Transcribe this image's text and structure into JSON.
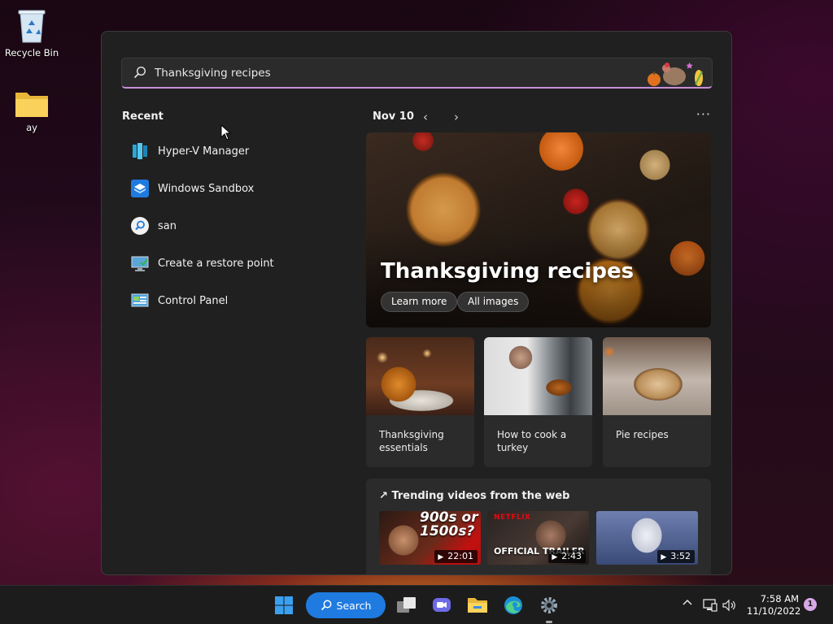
{
  "desktop": {
    "recycle_bin_label": "Recycle Bin",
    "folder_label": "ay"
  },
  "search": {
    "value": "Thanksgiving recipes"
  },
  "recent": {
    "title": "Recent",
    "items": [
      {
        "label": "Hyper-V Manager",
        "icon": "hyper-v-icon"
      },
      {
        "label": "Windows Sandbox",
        "icon": "sandbox-icon"
      },
      {
        "label": "san",
        "icon": "search-icon"
      },
      {
        "label": "Create a restore point",
        "icon": "system-properties-icon"
      },
      {
        "label": "Control Panel",
        "icon": "control-panel-icon"
      }
    ]
  },
  "highlights": {
    "date": "Nov 10",
    "hero": {
      "title": "Thanksgiving recipes",
      "buttons": [
        "Learn more",
        "All images"
      ]
    },
    "cards": [
      {
        "label": "Thanksgiving essentials"
      },
      {
        "label": "How to cook a turkey"
      },
      {
        "label": "Pie recipes"
      }
    ],
    "trending": {
      "title": "Trending videos from the web",
      "videos": [
        {
          "overlay": "900s or 1500s?",
          "duration": "22:01"
        },
        {
          "brand": "NETFLIX",
          "overlay": "OFFICIAL TRAILER",
          "duration": "2:43"
        },
        {
          "duration": "3:52"
        }
      ]
    }
  },
  "taskbar": {
    "search_label": "Search",
    "time": "7:58 AM",
    "date": "11/10/2022",
    "notification_count": "1"
  },
  "colors": {
    "accent": "#1f7be0",
    "search_underline": "#c98fd6",
    "panel_bg": "#202020"
  }
}
